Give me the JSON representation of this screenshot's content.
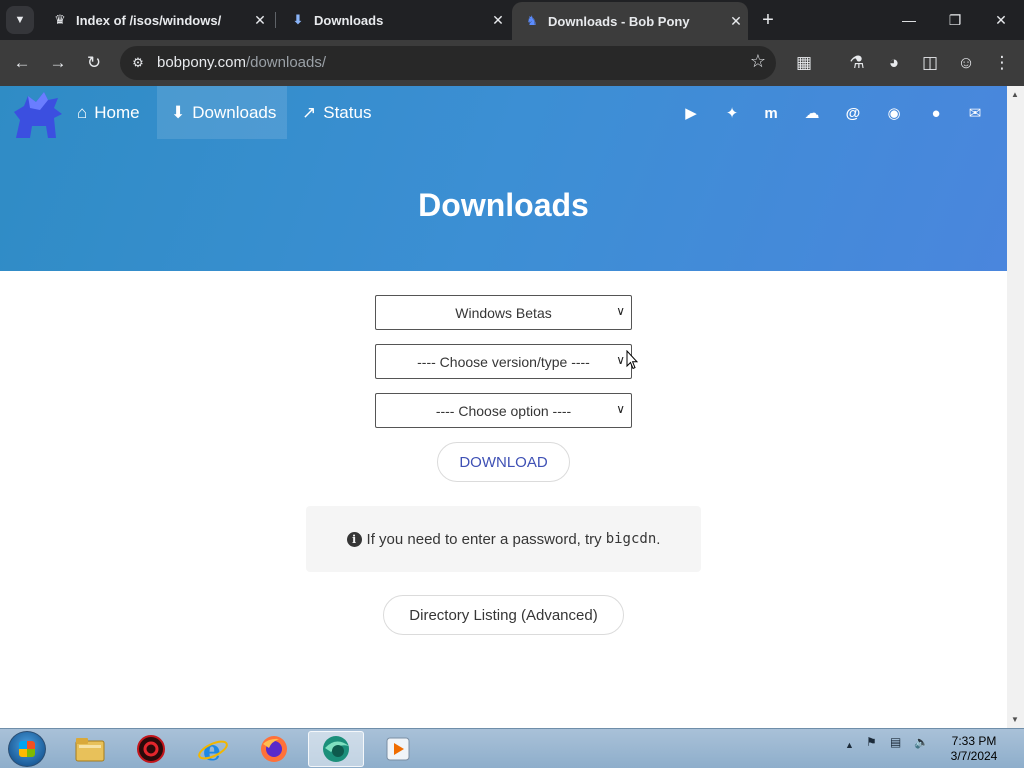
{
  "browser": {
    "tabs": [
      {
        "label": "Index of /isos/windows/",
        "icon": "pony-icon"
      },
      {
        "label": "Downloads",
        "icon": "download-icon"
      },
      {
        "label": "Downloads - Bob Pony",
        "icon": "pony-logo-icon",
        "active": true
      }
    ],
    "address": {
      "domain": "bobpony.com",
      "path": "/downloads/"
    }
  },
  "nav": {
    "items": [
      {
        "label": "Home",
        "icon": "home-icon"
      },
      {
        "label": "Downloads",
        "icon": "download-icon",
        "active": true
      },
      {
        "label": "Status",
        "icon": "trend-icon"
      }
    ],
    "social": [
      "youtube-icon",
      "twitter-icon",
      "mastodon-icon",
      "cloud-icon",
      "threads-icon",
      "discord-icon",
      "github-icon",
      "mail-icon"
    ]
  },
  "hero": {
    "title": "Downloads"
  },
  "form": {
    "category_select": "Windows Betas",
    "version_select": "---- Choose version/type ----",
    "option_select": "---- Choose option ----",
    "download_label": "DOWNLOAD"
  },
  "notice": {
    "text": "If you need to enter a password, try",
    "code": "bigcdn",
    "suffix": "."
  },
  "directory_button": "Directory Listing (Advanced)",
  "taskbar": {
    "time": "7:33 PM",
    "date": "3/7/2024"
  },
  "colors": {
    "hero": "#3c8fd4",
    "accent": "#3f51b5"
  }
}
